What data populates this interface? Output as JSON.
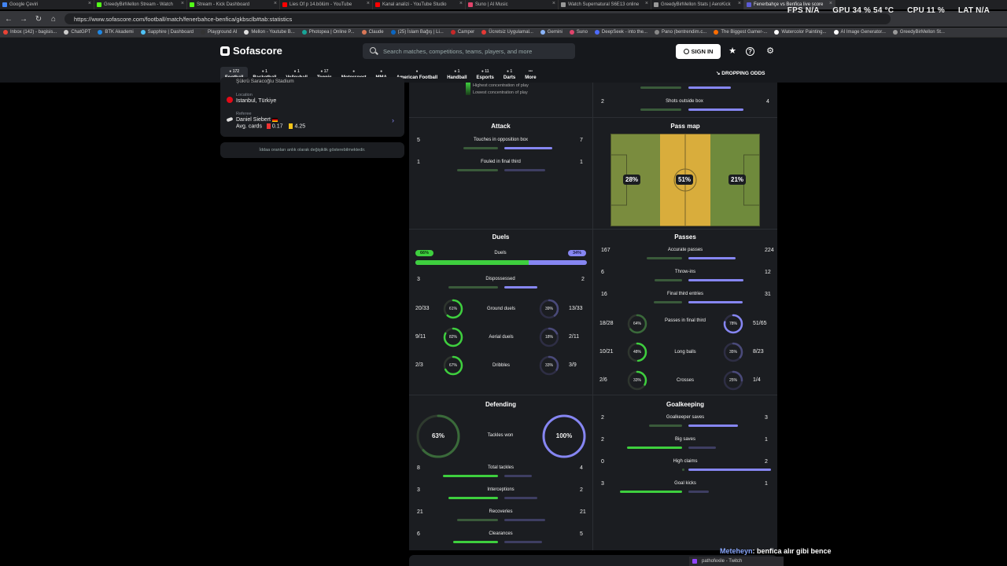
{
  "browser": {
    "tabs": [
      {
        "title": "Google Çeviri",
        "color": "#4285f4"
      },
      {
        "title": "GreedyBirMellon Stream - Watch",
        "color": "#53fc18"
      },
      {
        "title": "Stream - Kick Dashboard",
        "color": "#53fc18"
      },
      {
        "title": "Lies Of p 14.bölüm - YouTube",
        "color": "#ff0000"
      },
      {
        "title": "Kanal analizi - YouTube Studio",
        "color": "#ff0000"
      },
      {
        "title": "Suno | AI Music",
        "color": "#e0446b"
      },
      {
        "title": "Watch Supernatural S6E13 online",
        "color": "#999999"
      },
      {
        "title": "GreedyBirMellon Stats | AeroKick",
        "color": "#999999"
      },
      {
        "title": "Fenerbahçe vs Benfica live score",
        "color": "#5b5bd6"
      }
    ],
    "perf": {
      "fps": "FPS N/A",
      "gpu": "GPU 34 % 54 °C",
      "cpu": "CPU 11 %",
      "lat": "LAT N/A"
    },
    "url": "https://www.sofascore.com/football/match/fenerbahce-benfica/gkbsclb#tab:statistics",
    "bookmarks": [
      {
        "label": "Inbox (142) - bagisis...",
        "color": "#ea4335"
      },
      {
        "label": "ChatGPT",
        "color": "#cccccc"
      },
      {
        "label": "BTK Akademi",
        "color": "#1e88e5"
      },
      {
        "label": "Sapphire | Dashboard",
        "color": "#4fc3f7"
      },
      {
        "label": "Playground AI",
        "color": "#333333"
      },
      {
        "label": "Mellon - Youtube B...",
        "color": "#e0e0e0"
      },
      {
        "label": "Photopea | Online P...",
        "color": "#18a497"
      },
      {
        "label": "Claude",
        "color": "#d97757"
      },
      {
        "label": "(25) İslam Bağış | Li...",
        "color": "#0a66c2"
      },
      {
        "label": "Camper",
        "color": "#c62828"
      },
      {
        "label": "Ücretsiz Uygulamal...",
        "color": "#e53935"
      },
      {
        "label": "Gemini",
        "color": "#8ab4f8"
      },
      {
        "label": "Suno",
        "color": "#e0446b"
      },
      {
        "label": "DeepSeek - into the...",
        "color": "#4d6bfe"
      },
      {
        "label": "Pano (bentrendim.c...",
        "color": "#888888"
      },
      {
        "label": "The Biggest Gamer-...",
        "color": "#ff6d00"
      },
      {
        "label": "Watercolor Painting...",
        "color": "#ffffff"
      },
      {
        "label": "AI Image Generator...",
        "color": "#ffffff"
      },
      {
        "label": "GreedyBirMellon St...",
        "color": "#999999"
      }
    ]
  },
  "header": {
    "logo": "Sofascore",
    "search_placeholder": "Search matches, competitions, teams, players, and more",
    "signin": "SIGN IN",
    "dropping": "DROPPING ODDS",
    "sports": [
      {
        "label": "Football",
        "count": "172"
      },
      {
        "label": "Basketball",
        "count": "1"
      },
      {
        "label": "Volleyball",
        "count": "1"
      },
      {
        "label": "Tennis",
        "count": "17"
      },
      {
        "label": "Motorsport",
        "count": ""
      },
      {
        "label": "MMA",
        "count": ""
      },
      {
        "label": "American Football",
        "count": ""
      },
      {
        "label": "Handball",
        "count": "1"
      },
      {
        "label": "Esports",
        "count": "11"
      },
      {
        "label": "Darts",
        "count": "1"
      },
      {
        "label": "More",
        "count": ""
      }
    ]
  },
  "left": {
    "stadium": "Şükrü Saracoğlu Stadium",
    "location_label": "Location",
    "location": "Istanbul, Türkiye",
    "referee_label": "Referee",
    "referee": "Daniel Siebert",
    "avg_cards_label": "Avg. cards",
    "red_avg": "0.17",
    "yellow_avg": "4.25",
    "odds_note": "İddaa oranları anlık olarak değişiklik gösterebilmektedir."
  },
  "stats": {
    "legend_high": "Highest concentration of play",
    "legend_low": "Lowest concentration of play",
    "shots_outside": {
      "label": "Shots outside box",
      "home": "2",
      "away": "4"
    },
    "attack": {
      "title": "Attack",
      "rows": [
        {
          "label": "Touches in opposition box",
          "home": "5",
          "away": "7"
        },
        {
          "label": "Fouled in final third",
          "home": "1",
          "away": "1"
        }
      ]
    },
    "passmap": {
      "title": "Pass map",
      "left": "28%",
      "mid": "51%",
      "right": "21%"
    },
    "duels": {
      "title": "Duels",
      "main": {
        "label": "Duels",
        "home": "66%",
        "away": "34%",
        "home_frac": 0.66
      },
      "dispossessed": {
        "label": "Dispossessed",
        "home": "3",
        "away": "2"
      },
      "rings": [
        {
          "label": "Ground duels",
          "home": "20/33",
          "home_pct": "61%",
          "away_pct": "39%",
          "away": "13/33",
          "h": 0.61,
          "a": 0.39
        },
        {
          "label": "Aerial duels",
          "home": "9/11",
          "home_pct": "82%",
          "away_pct": "18%",
          "away": "2/11",
          "h": 0.82,
          "a": 0.18
        },
        {
          "label": "Dribbles",
          "home": "2/3",
          "home_pct": "67%",
          "away_pct": "33%",
          "away": "3/9",
          "h": 0.67,
          "a": 0.33
        }
      ]
    },
    "passes": {
      "title": "Passes",
      "rows": [
        {
          "label": "Accurate passes",
          "home": "167",
          "away": "224"
        },
        {
          "label": "Throw-ins",
          "home": "6",
          "away": "12"
        },
        {
          "label": "Final third entries",
          "home": "16",
          "away": "31"
        }
      ],
      "rings": [
        {
          "label": "Passes in final third",
          "home": "18/28",
          "home_pct": "64%",
          "away_pct": "78%",
          "away": "51/65",
          "h": 0.64,
          "a": 0.78
        },
        {
          "label": "Long balls",
          "home": "10/21",
          "home_pct": "48%",
          "away_pct": "35%",
          "away": "8/23",
          "h": 0.48,
          "a": 0.35
        },
        {
          "label": "Crosses",
          "home": "2/6",
          "home_pct": "33%",
          "away_pct": "25%",
          "away": "1/4",
          "h": 0.33,
          "a": 0.25
        }
      ]
    },
    "defending": {
      "title": "Defending",
      "tackles_won_label": "Tackles won",
      "home_pct": "63%",
      "away_pct": "100%",
      "h": 0.63,
      "a": 1.0,
      "rows": [
        {
          "label": "Total tackles",
          "home": "8",
          "away": "4"
        },
        {
          "label": "Interceptions",
          "home": "3",
          "away": "2"
        },
        {
          "label": "Recoveries",
          "home": "21",
          "away": "21"
        },
        {
          "label": "Clearances",
          "home": "6",
          "away": "5"
        }
      ]
    },
    "goalkeeping": {
      "title": "Goalkeeping",
      "rows": [
        {
          "label": "Goalkeeper saves",
          "home": "2",
          "away": "3"
        },
        {
          "label": "Big saves",
          "home": "2",
          "away": "1"
        },
        {
          "label": "High claims",
          "home": "0",
          "away": "2"
        },
        {
          "label": "Goal kicks",
          "home": "3",
          "away": "1"
        }
      ]
    }
  },
  "chat": {
    "user": "Meteheyn",
    "message": ": benfica alır gibi bence",
    "twitch_tab": "pathofexile - Twitch"
  },
  "colors": {
    "home": "#3ecf3e",
    "away": "#8686f2",
    "bg": "#1b1d21"
  }
}
